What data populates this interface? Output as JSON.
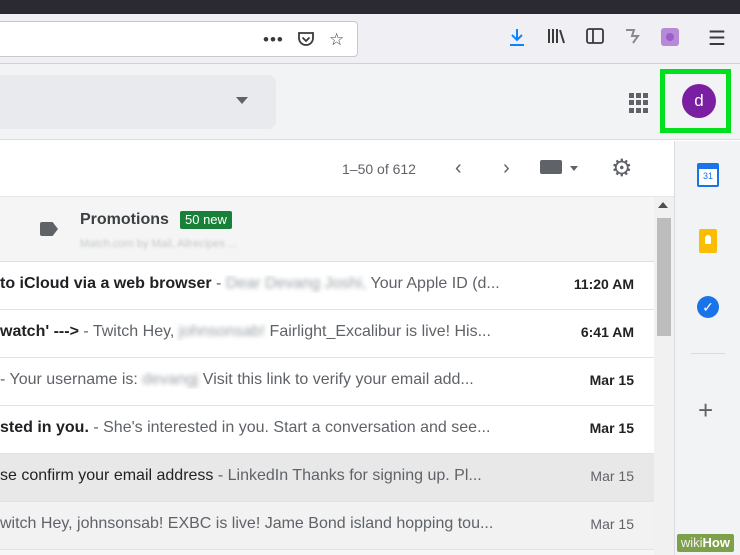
{
  "browser": {
    "url_icons": [
      "more-dots-icon",
      "pocket-icon",
      "star-icon"
    ],
    "toolbar_icons": [
      "download-icon",
      "library-icon",
      "sidebar-icon",
      "extension-icon",
      "extension-purple-icon",
      "menu-icon"
    ]
  },
  "header": {
    "avatar_letter": "d",
    "apps_icon": "apps-grid-icon",
    "highlight_color": "#00e01e"
  },
  "list": {
    "pagination": "1–50 of 612",
    "promotions": {
      "title": "Promotions",
      "badge": "50 new",
      "subtitle": "Match.com by Mail, Allrecipes ..."
    },
    "rows": [
      {
        "subject": "to iCloud via a web browser",
        "sep": " - ",
        "blur": "Dear Devang Joshi,",
        "snippet": " Your Apple ID (d...",
        "date": "11:20 AM",
        "unread": true
      },
      {
        "subject": "watch' --->",
        "sep": " - Twitch Hey,",
        "blur": " johnsonsab!",
        "snippet": " Fairlight_Excalibur is live! His...",
        "date": "6:41 AM",
        "unread": true
      },
      {
        "subject": "",
        "sep": "- Your username is:",
        "blur": " devangj",
        "snippet": " Visit this link to verify your email add...",
        "date": "Mar 15",
        "unread": true
      },
      {
        "subject": "sted in you.",
        "sep": " - She's interested in you. Start a conversation and see...",
        "blur": "",
        "snippet": "",
        "date": "Mar 15",
        "unread": true
      },
      {
        "subject": "se confirm your email address",
        "sep": " - LinkedIn Thanks for signing up. Pl...",
        "blur": "",
        "snippet": "",
        "date": "Mar 15",
        "unread": false
      },
      {
        "subject": "",
        "sep": "witch Hey, johnsonsab! EXBC is live! Jame Bond island hopping tou...",
        "blur": "",
        "snippet": "",
        "date": "Mar 15",
        "unread": false
      }
    ]
  },
  "side_panel": {
    "calendar_day": "31",
    "icons": [
      "calendar-icon",
      "keep-icon",
      "tasks-icon",
      "add-icon"
    ]
  },
  "watermark": {
    "wiki": "wiki",
    "how": "How"
  }
}
